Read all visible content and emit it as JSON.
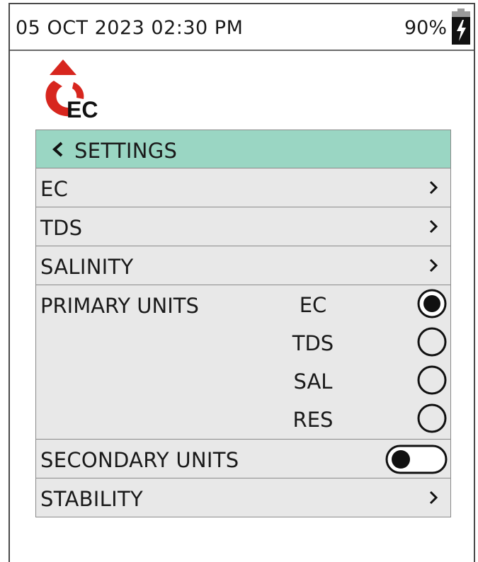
{
  "status": {
    "datetime": "05 OCT 2023 02:30 PM",
    "battery": "90%"
  },
  "logo": {
    "text": "EC",
    "accent": "#d7261e"
  },
  "header": {
    "title": "SETTINGS",
    "color": "#9ad6c3"
  },
  "items": {
    "ec": "EC",
    "tds": "TDS",
    "salinity": "SALINITY",
    "primary": "PRIMARY UNITS",
    "secondary": "SECONDARY UNITS",
    "stability": "STABILITY"
  },
  "primary_options": [
    {
      "label": "EC",
      "selected": true
    },
    {
      "label": "TDS",
      "selected": false
    },
    {
      "label": "SAL",
      "selected": false
    },
    {
      "label": "RES",
      "selected": false
    }
  ],
  "secondary_units_enabled": false
}
